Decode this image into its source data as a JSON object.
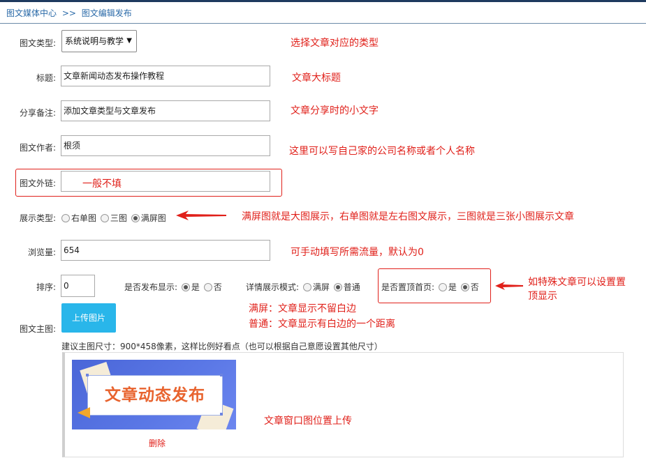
{
  "breadcrumb": {
    "root": "图文媒体中心",
    "sep": ">>",
    "current": "图文编辑发布"
  },
  "form": {
    "type_label": "图文类型:",
    "type_value": "系统说明与教学",
    "title_label": "标题:",
    "title_value": "文章新闻动态发布操作教程",
    "share_label": "分享备注:",
    "share_value": "添加文章类型与文章发布",
    "author_label": "图文作者:",
    "author_value": "根须",
    "link_label": "图文外链:",
    "link_value": "",
    "display_label": "展示类型:",
    "display_options": [
      "右单图",
      "三图",
      "满屏图"
    ],
    "display_selected": "满屏图",
    "views_label": "浏览量:",
    "views_value": "654",
    "sort_label": "排序:",
    "sort_value": "0",
    "publish_label": "是否发布显示:",
    "publish_options": [
      "是",
      "否"
    ],
    "publish_selected": "是",
    "detail_label": "详情展示模式:",
    "detail_options": [
      "满屏",
      "普通"
    ],
    "detail_selected": "普通",
    "top_label": "是否置顶首页:",
    "top_options": [
      "是",
      "否"
    ],
    "top_selected": "否",
    "image_label": "图文主图:",
    "upload_button": "上传图片",
    "size_hint": "建议主图尺寸：900*458像素，这样比例好看点（也可以根据自己意愿设置其他尺寸）",
    "thumb_text": "文章动态发布",
    "delete_label": "删除"
  },
  "notes": {
    "type": "选择文章对应的类型",
    "title": "文章大标题",
    "share": "文章分享时的小文字",
    "author": "这里可以写自己家的公司名称或者个人名称",
    "link": "一般不填",
    "display": "满屏图就是大图展示，右单图就是左右图文展示，三图就是三张小图展示文章",
    "views": "可手动填写所需流量，默认为0",
    "top_line1": "如特殊文章可以设置置",
    "top_line2": "顶显示",
    "detail_line1": "满屏：文章显示不留白边",
    "detail_line2": "普通：文章显示有白边的一个距离",
    "thumb": "文章窗口图位置上传"
  },
  "colors": {
    "annotation": "#e0201a",
    "upload_button": "#29b6ea",
    "breadcrumb": "#2a6aa8"
  }
}
